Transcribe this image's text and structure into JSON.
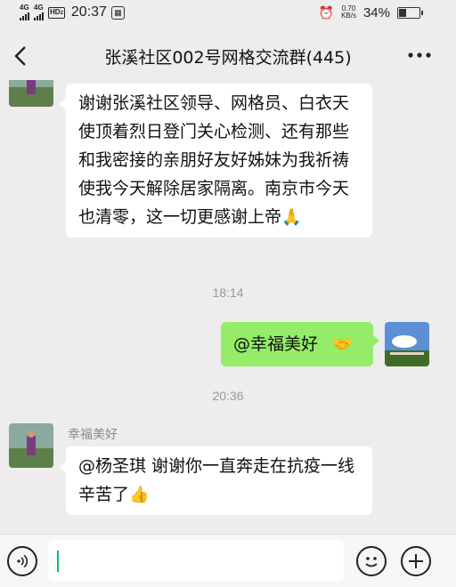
{
  "status_bar": {
    "network_1": "4G",
    "network_2": "4G",
    "hd_badge": "HD",
    "hd_index": "2",
    "time": "20:37",
    "app_icon": "image-icon",
    "alarm_icon": "alarm-clock-icon",
    "speed_value": "0.70",
    "speed_unit": "KB/s",
    "battery": "34%"
  },
  "header": {
    "title": "张溪社区002号网格交流群(445)",
    "back_icon": "chevron-left-icon",
    "more_icon": "more-dots-icon"
  },
  "messages": [
    {
      "side": "left",
      "text": "谢谢张溪社区领导、网格员、白衣天使顶着烈日登门关心检测、还有那些和我密接的亲朋好友好姊妹为我祈祷使我今天解除居家隔离。南京市今天也清零，这一切更感谢上帝",
      "emoji": "🙏"
    },
    {
      "timestamp": "18:14"
    },
    {
      "side": "right",
      "text": "@幸福美好",
      "emoji": "🤝"
    },
    {
      "timestamp": "20:36"
    },
    {
      "side": "left",
      "sender": "幸福美好",
      "text": "@杨圣琪  谢谢你一直奔走在抗疫一线辛苦了",
      "emoji": "👍"
    }
  ],
  "input_bar": {
    "voice_icon": "voice-icon",
    "emoji_icon": "emoji-icon",
    "plus_icon": "plus-icon",
    "value": ""
  },
  "colors": {
    "background": "#ededed",
    "bubble_in": "#ffffff",
    "bubble_out": "#95ec69",
    "accent": "#07c160"
  }
}
